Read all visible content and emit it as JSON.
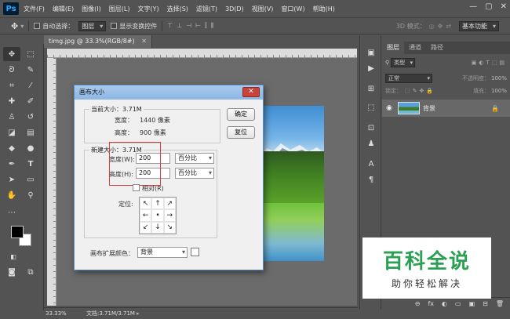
{
  "app": {
    "logo": "Ps"
  },
  "menu": [
    "文件(F)",
    "编辑(E)",
    "图像(I)",
    "图层(L)",
    "文字(Y)",
    "选择(S)",
    "滤镜(T)",
    "3D(D)",
    "视图(V)",
    "窗口(W)",
    "帮助(H)"
  ],
  "window_controls": {
    "minimize": "—",
    "maximize": "▢",
    "close": "✕"
  },
  "options": {
    "auto_select_label": "自动选择：",
    "auto_select_value": "图层",
    "show_transform_label": "显示变换控件",
    "mode_3d_label": "3D 模式：",
    "workspace": "基本功能"
  },
  "document": {
    "tab_label": "timg.jpg @ 33.3%(RGB/8#)",
    "zoom": "33.33%",
    "doc_size": "文档:3.71M/3.71M"
  },
  "layers_panel": {
    "tabs": [
      "图层",
      "通道",
      "路径"
    ],
    "kind_filter": "类型",
    "blend_mode": "正常",
    "opacity_label": "不透明度：",
    "opacity": "100%",
    "lock_label": "锁定：",
    "fill_label": "填充：",
    "fill": "100%",
    "layer_name": "背景",
    "footer_icons": [
      "fx",
      "◐",
      "▭",
      "▣",
      "⊟",
      "🗑"
    ]
  },
  "dialog": {
    "title": "画布大小",
    "close": "✕",
    "current_size_label": "当前大小：3.71M",
    "current_width_label": "宽度：",
    "current_width_value": "1440 像素",
    "current_height_label": "高度：",
    "current_height_value": "900 像素",
    "new_size_label": "新建大小：3.71M",
    "width_label": "宽度(W):",
    "width_value": "200",
    "height_label": "高度(H):",
    "height_value": "200",
    "unit_width": "百分比",
    "unit_height": "百分比",
    "relative_label": "相对(R)",
    "anchor_label": "定位:",
    "anchor_arrows": [
      "↖",
      "↑",
      "↗",
      "←",
      "•",
      "→",
      "↙",
      "↓",
      "↘"
    ],
    "ok_label": "确定",
    "reset_label": "复位",
    "ext_color_label": "画布扩展颜色：",
    "ext_color_value": "背景"
  },
  "watermark": {
    "title": "百科全说",
    "subtitle": "助你轻松解决"
  },
  "colors": {
    "accent_title": "#8db6e3",
    "highlight": "#e03a3a",
    "watermark_green": "#2aa052"
  }
}
